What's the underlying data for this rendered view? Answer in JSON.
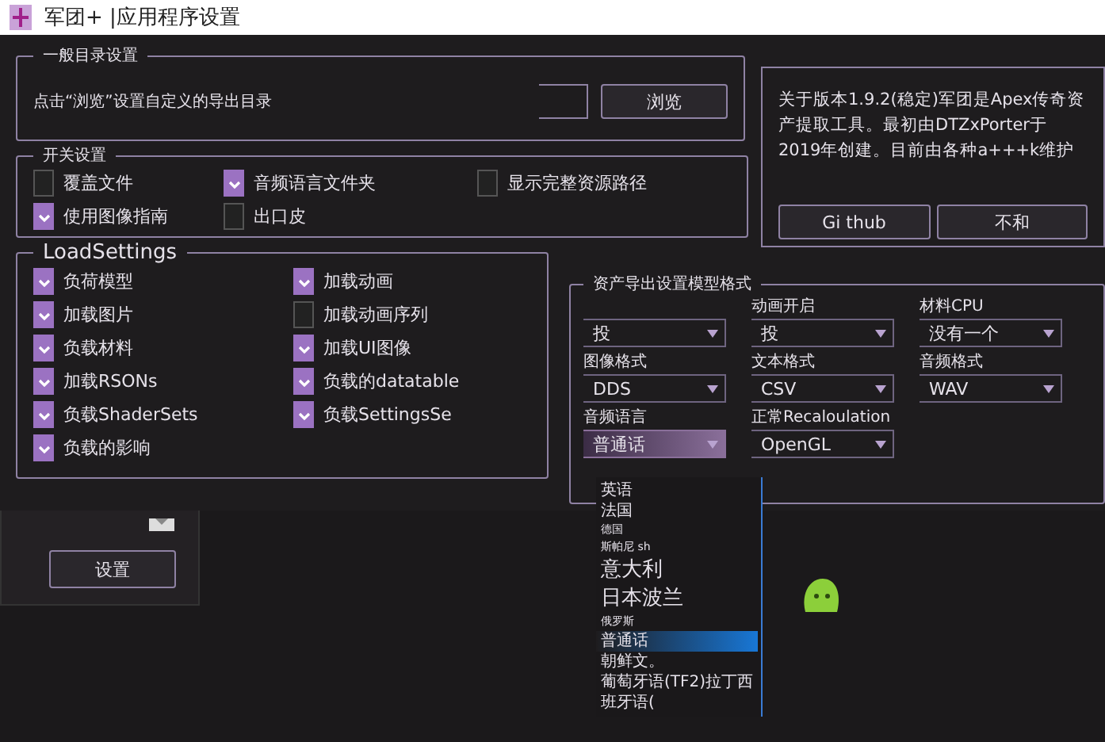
{
  "window": {
    "title": "军团+ |应用程序设置"
  },
  "directory": {
    "title": "一般目录设置",
    "hint": "点击“浏览”设置自定义的导出目录",
    "browse_button": "浏览"
  },
  "switches": {
    "title": "开关设置",
    "items": [
      {
        "label": "覆盖文件",
        "checked": false
      },
      {
        "label": "音频语言文件夹",
        "checked": true
      },
      {
        "label": "显示完整资源路径",
        "checked": false
      },
      {
        "label": "使用图像指南",
        "checked": true
      },
      {
        "label": "出口皮",
        "checked": false
      }
    ]
  },
  "about": {
    "text": "关于版本1.9.2(稳定)军团是Apex传奇资产提取工具。最初由DTZxPorter于2019年创建。目前由各种a+++k维护",
    "buttons": [
      "Gi thub",
      "不和"
    ]
  },
  "load_settings": {
    "title": "LoadSettings",
    "columns": [
      [
        {
          "label": "负荷模型",
          "checked": true
        },
        {
          "label": "加载图片",
          "checked": true
        },
        {
          "label": "负载材料",
          "checked": true
        },
        {
          "label": "加载RSONs",
          "checked": true
        },
        {
          "label": "负载ShaderSets",
          "checked": true
        },
        {
          "label": "负载的影响",
          "checked": true
        }
      ],
      [
        {
          "label": "加载动画",
          "checked": true
        },
        {
          "label": "加载动画序列",
          "checked": false
        },
        {
          "label": "加载UI图像",
          "checked": true
        },
        {
          "label": "负载的datatable",
          "checked": true
        },
        {
          "label": "负载SettingsSe",
          "checked": true
        }
      ]
    ]
  },
  "export": {
    "title": "资产导出设置模型格式",
    "fields": [
      {
        "value": "投"
      },
      {
        "label": "动画开启",
        "value": "投"
      },
      {
        "label": "材料CPU",
        "value": "没有一个"
      },
      {
        "label": "图像格式",
        "value": "DDS"
      },
      {
        "label": "文本格式",
        "value": "CSV"
      },
      {
        "label": "音频格式",
        "value": "WAV"
      },
      {
        "label": "音频语言",
        "value": "普通话",
        "expanded": true
      },
      {
        "label": "正常Recaloulation",
        "value": "OpenGL"
      }
    ]
  },
  "language_list": [
    {
      "label": "英语",
      "kind": "normal",
      "selected": false
    },
    {
      "label": "法国",
      "kind": "normal",
      "selected": false
    },
    {
      "label": "德国",
      "kind": "small",
      "selected": false
    },
    {
      "label": "斯帕尼 sh",
      "kind": "small",
      "selected": false
    },
    {
      "label": "意大利",
      "kind": "large",
      "selected": false
    },
    {
      "label": "日本波兰",
      "kind": "large",
      "selected": false
    },
    {
      "label": "俄罗斯",
      "kind": "small",
      "selected": false
    },
    {
      "label": "普通话",
      "kind": "normal",
      "selected": true
    },
    {
      "label": "朝鲜文。",
      "kind": "normal",
      "selected": false
    },
    {
      "label": "葡萄牙语(TF2)拉丁西",
      "kind": "normal",
      "selected": false
    },
    {
      "label": "班牙语(",
      "kind": "normal",
      "selected": false
    }
  ],
  "back_window": {
    "button": "设置"
  }
}
